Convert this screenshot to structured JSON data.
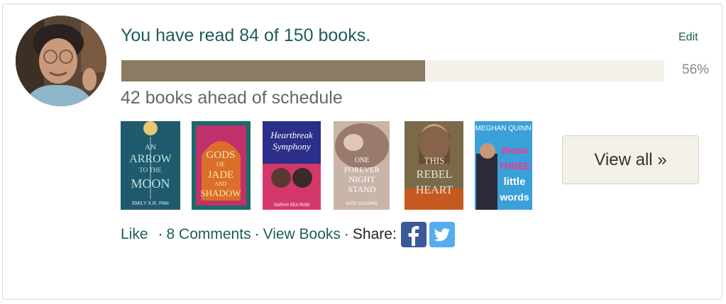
{
  "challenge": {
    "title": "You have read 84 of 150 books.",
    "edit_label": "Edit",
    "progress": 0.56,
    "percent_label": "56%",
    "status": "42 books ahead of schedule"
  },
  "colors": {
    "accent": "#1d5e57",
    "progress_fill": "#8b7b62",
    "progress_track": "#f4f1ea",
    "facebook": "#3b5998",
    "twitter": "#55acee"
  },
  "books": [
    {
      "name": "book-cover-an-arrow-to-the-moon",
      "lines": [
        "AN",
        "ARROW",
        "TO THE",
        "MOON"
      ],
      "author": "EMILY X.R. PAN"
    },
    {
      "name": "book-cover-gods-of-jade-and-shadow",
      "lines": [
        "GODS",
        "OF",
        "JADE",
        "AND",
        "SHADOW"
      ],
      "author": ""
    },
    {
      "name": "book-cover-heartbreak-symphony",
      "lines": [
        "Heartbreak",
        "Symphony"
      ],
      "author": "SARAH SEA ROM"
    },
    {
      "name": "book-cover-one-forever-night-stand",
      "lines": [
        "ONE",
        "FOREVER",
        "NIGHT",
        "STAND"
      ],
      "author": "KATE GOLDING"
    },
    {
      "name": "book-cover-this-rebel-heart",
      "lines": [
        "THIS",
        "REBEL",
        "HEART"
      ],
      "author": ""
    },
    {
      "name": "book-cover-those-three-little-words",
      "lines": [
        "those",
        "THREE",
        "little",
        "words"
      ],
      "author": "MEGHAN QUINN"
    }
  ],
  "view_all_label": "View all »",
  "footer": {
    "like": "Like",
    "comments": "8 Comments",
    "view_books": "View Books",
    "share": "Share:",
    "sep": "·"
  },
  "icons": {
    "facebook": "facebook-icon",
    "twitter": "twitter-icon"
  }
}
